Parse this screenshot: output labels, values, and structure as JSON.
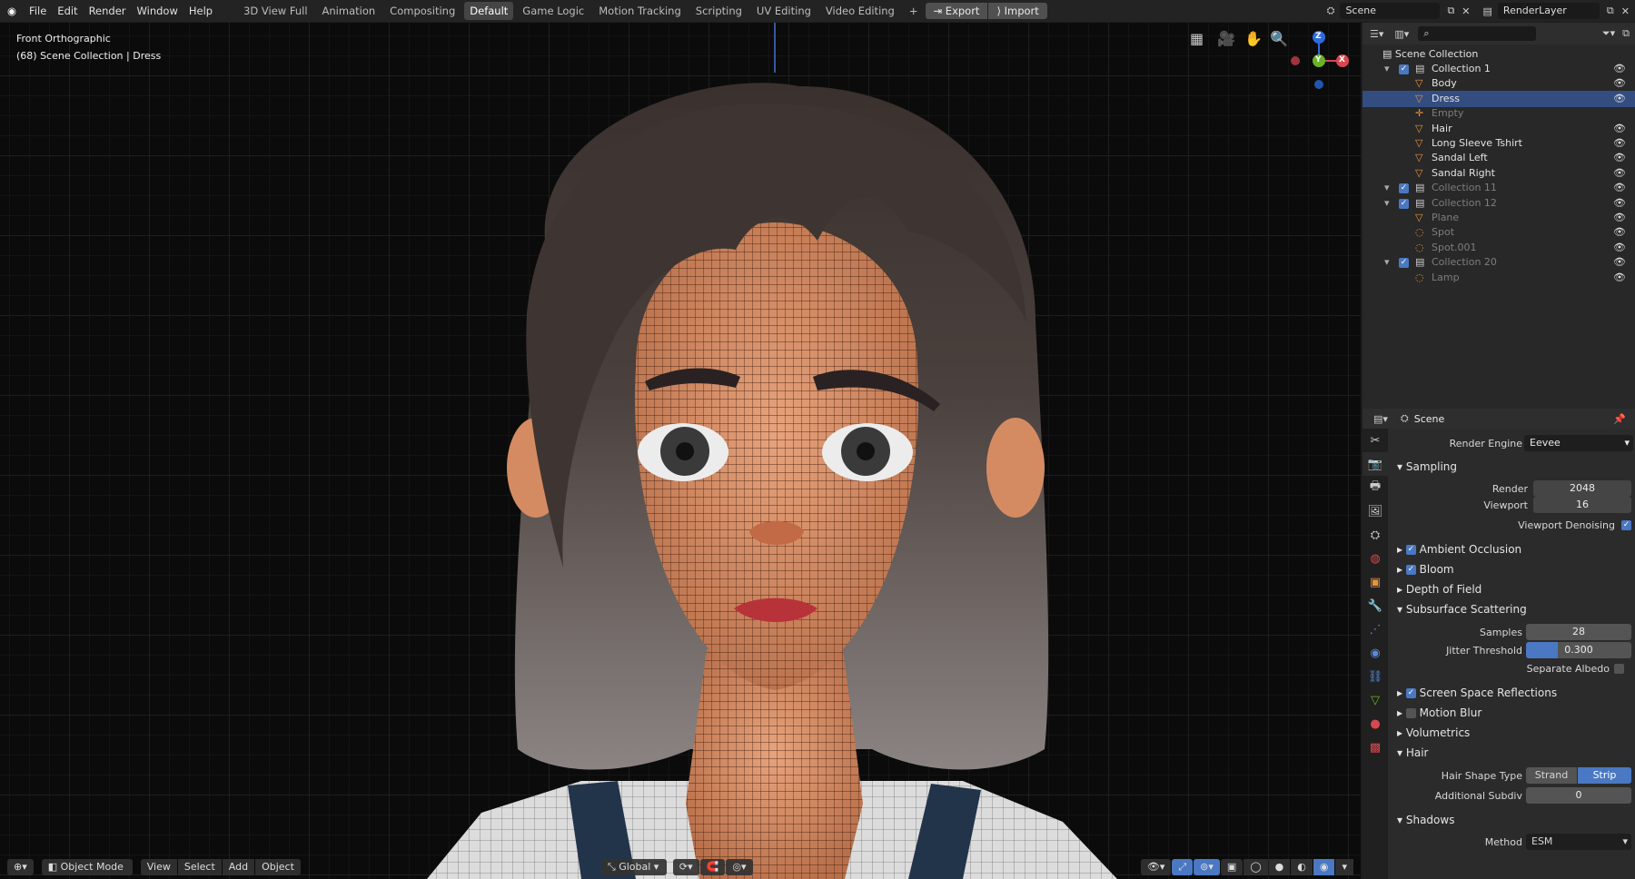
{
  "menu": {
    "file": "File",
    "edit": "Edit",
    "render": "Render",
    "window": "Window",
    "help": "Help"
  },
  "workspaces": [
    "3D View Full",
    "Animation",
    "Compositing",
    "Default",
    "Game Logic",
    "Motion Tracking",
    "Scripting",
    "UV Editing",
    "Video Editing"
  ],
  "topbar": {
    "add": "+",
    "export": "Export",
    "import": "Import",
    "scene": "Scene",
    "layer": "RenderLayer"
  },
  "viewport": {
    "view_name": "Front Orthographic",
    "context": "(68) Scene Collection | Dress",
    "axis_z": "Z",
    "axis_y": "Y",
    "axis_x": "X",
    "mode": "Object Mode",
    "view": "View",
    "select": "Select",
    "add": "Add",
    "object": "Object",
    "orientation": "Global"
  },
  "outliner": {
    "root": "Scene Collection",
    "rows": [
      {
        "label": "Collection 1",
        "dim": false,
        "eye": "👁"
      },
      {
        "label": "Body",
        "dim": false,
        "eye": "👁"
      },
      {
        "label": "Dress",
        "dim": false,
        "eye": "👁"
      },
      {
        "label": "Empty",
        "dim": true,
        "eye": ""
      },
      {
        "label": "Hair",
        "dim": false,
        "eye": "👁"
      },
      {
        "label": "Long Sleeve Tshirt",
        "dim": false,
        "eye": "👁"
      },
      {
        "label": "Sandal Left",
        "dim": false,
        "eye": "👁"
      },
      {
        "label": "Sandal Right",
        "dim": false,
        "eye": "👁"
      },
      {
        "label": "Collection 11",
        "dim": true,
        "eye": "👁"
      },
      {
        "label": "Collection 12",
        "dim": true,
        "eye": "👁"
      },
      {
        "label": "Plane",
        "dim": true,
        "eye": "👁"
      },
      {
        "label": "Spot",
        "dim": true,
        "eye": "👁"
      },
      {
        "label": "Spot.001",
        "dim": true,
        "eye": "👁"
      },
      {
        "label": "Collection 20",
        "dim": true,
        "eye": "👁"
      },
      {
        "label": "Lamp",
        "dim": true,
        "eye": "👁"
      }
    ]
  },
  "props": {
    "context": "Scene",
    "render_engine_label": "Render Engine",
    "render_engine": "Eevee",
    "sampling": "Sampling",
    "render_label": "Render",
    "render_val": "2048",
    "viewport_label": "Viewport",
    "viewport_val": "16",
    "denoise_label": "Viewport Denoising",
    "ao": "Ambient Occlusion",
    "bloom": "Bloom",
    "dof": "Depth of Field",
    "sss": "Subsurface Scattering",
    "samples_label": "Samples",
    "samples_val": "28",
    "jitter_label": "Jitter Threshold",
    "jitter_val": "0.300",
    "jitter_fraction": 0.3,
    "sep_albedo": "Separate Albedo",
    "ssr": "Screen Space Reflections",
    "motion_blur": "Motion Blur",
    "volumetrics": "Volumetrics",
    "hair": "Hair",
    "hair_shape_label": "Hair Shape Type",
    "strand": "Strand",
    "strip": "Strip",
    "subdiv_label": "Additional Subdiv",
    "subdiv_val": "0",
    "shadows": "Shadows",
    "method_label": "Method",
    "method": "ESM"
  },
  "colors": {
    "accent": "#4a78c2",
    "orange": "#e8933d"
  }
}
